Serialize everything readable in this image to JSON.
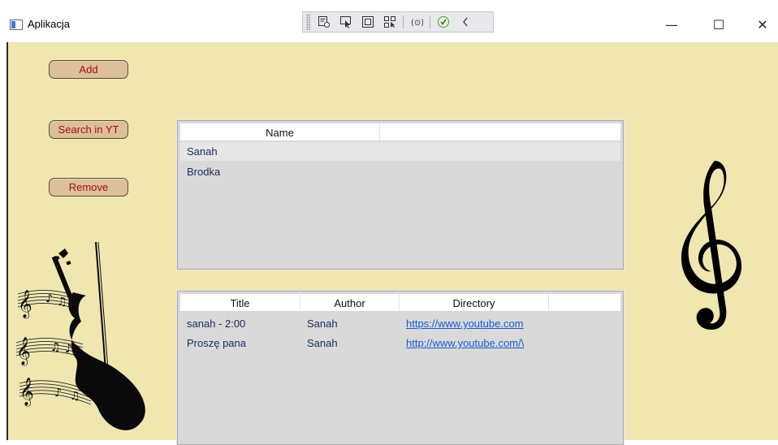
{
  "window": {
    "title": "Aplikacja",
    "controls": {
      "minimize": "—",
      "maximize": "☐",
      "close": "✕"
    }
  },
  "debug_toolbar": {
    "icons": [
      "select-element-icon",
      "pointer-icon",
      "layout-adorner-icon",
      "track-focus-icon",
      "hot-reload-icon",
      "check-icon",
      "collapse-icon"
    ]
  },
  "sidebar": {
    "add_label": "Add",
    "search_label": "Search in YT",
    "remove_label": "Remove"
  },
  "artists": {
    "columns": [
      "Name",
      ""
    ],
    "rows": [
      {
        "name": "Sanah",
        "selected": true
      },
      {
        "name": "Brodka",
        "selected": false
      }
    ]
  },
  "songs": {
    "columns": [
      "Title",
      "Author",
      "Directory",
      ""
    ],
    "rows": [
      {
        "title": "sanah - 2:00",
        "author": "Sanah",
        "directory": "https://www.youtube.com"
      },
      {
        "title": "Proszę pana",
        "author": "Sanah",
        "directory": "http://www.youtube.com/\\"
      }
    ]
  },
  "colors": {
    "background": "#f0e6b0",
    "button_fill": "#dcc09a",
    "button_text": "#a01010",
    "link": "#1a5bd8"
  }
}
